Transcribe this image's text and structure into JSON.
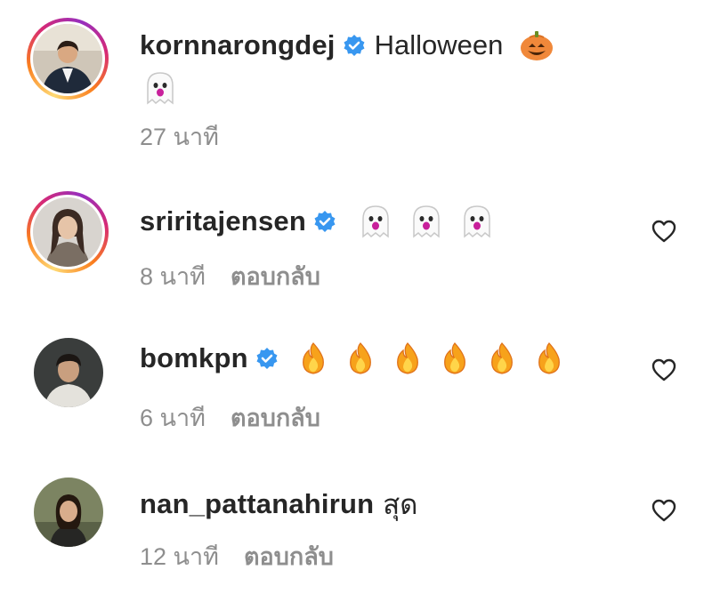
{
  "comments": [
    {
      "username": "kornnarongdej",
      "verified": true,
      "text": "Halloween",
      "emojis_line1": [
        "pumpkin"
      ],
      "emojis_line2": [
        "ghost"
      ],
      "time": "27 นาที",
      "reply_label": "",
      "story_ring": true
    },
    {
      "username": "sriritajensen",
      "verified": true,
      "text": "",
      "emojis_line1": [
        "ghost",
        "ghost",
        "ghost"
      ],
      "time": "8 นาที",
      "reply_label": "ตอบกลับ",
      "story_ring": true
    },
    {
      "username": "bomkpn",
      "verified": true,
      "text": "",
      "emojis_line1": [
        "fire",
        "fire",
        "fire",
        "fire",
        "fire",
        "fire"
      ],
      "time": "6 นาที",
      "reply_label": "ตอบกลับ",
      "story_ring": false
    },
    {
      "username": "nan_pattanahirun",
      "verified": false,
      "text": "สุด",
      "emojis_line1": [],
      "time": "12 นาที",
      "reply_label": "ตอบกลับ",
      "story_ring": false
    }
  ],
  "icons": {
    "verified": "verified-badge-icon",
    "like": "heart-outline-icon"
  },
  "colors": {
    "verified_blue": "#3897f0",
    "secondary_text": "#8e8e8e",
    "primary_text": "#262626"
  }
}
